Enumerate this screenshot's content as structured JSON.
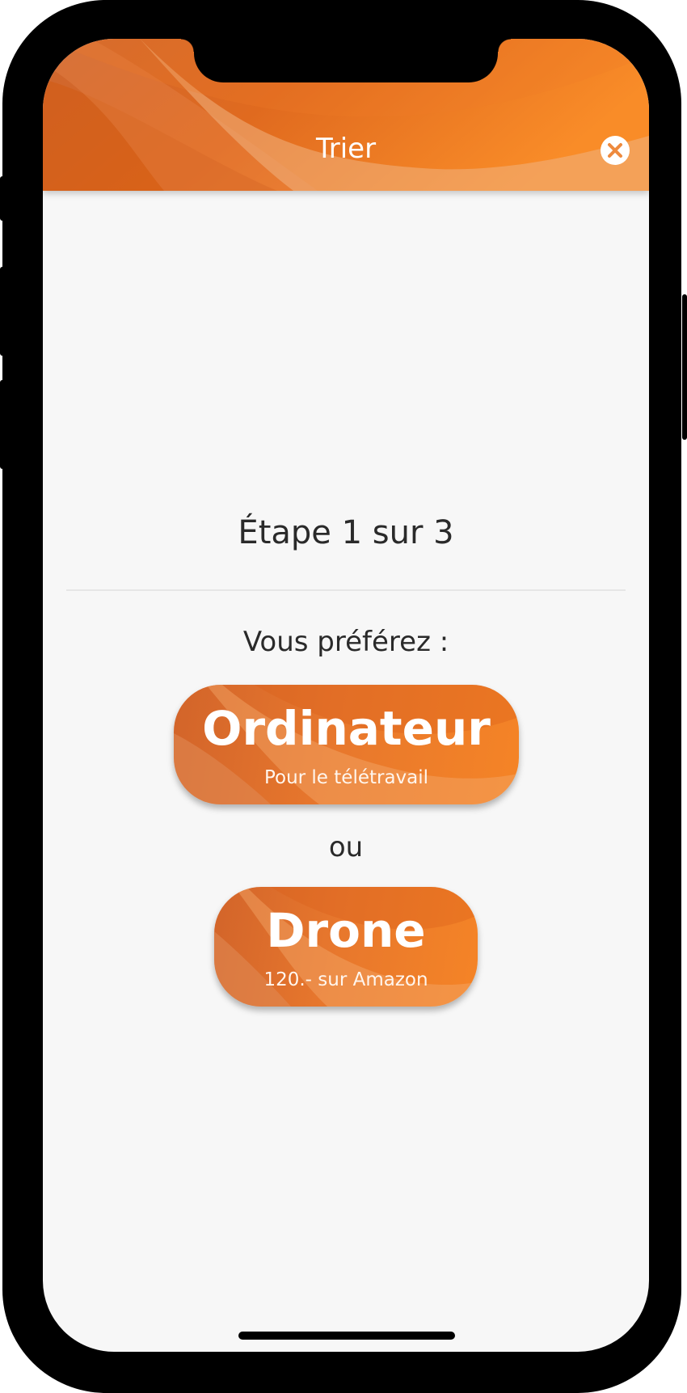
{
  "header": {
    "title": "Trier",
    "close_icon": "close-circle-icon",
    "gradient": [
      "#d9611f",
      "#f98b28",
      "#f7b27a"
    ]
  },
  "step": {
    "label": "Étape 1 sur 3"
  },
  "question": {
    "label": "Vous préférez :"
  },
  "choices": [
    {
      "title": "Ordinateur",
      "subtitle": "Pour le télétravail"
    },
    {
      "title": "Drone",
      "subtitle": "120.- sur Amazon"
    }
  ],
  "separator": {
    "label": "ou"
  },
  "colors": {
    "accent": "#f07d28",
    "background": "#f7f7f7",
    "text": "#2a2a2a"
  }
}
